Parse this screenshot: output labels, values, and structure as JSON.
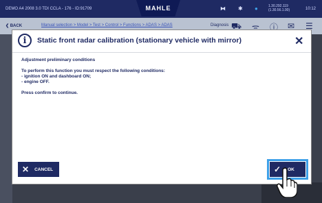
{
  "statusbar": {
    "vehicle": "DEMO A4 2008 3.0 TDI CCLA - 176 - ID:91709",
    "brand": "MAHLE",
    "ip_line1": "1.30.292.119",
    "ip_line2": "(1.30.56.1.00)",
    "clock": "10:12",
    "icons": [
      "vci-icon",
      "bluetooth-icon",
      "wifi-dot-icon"
    ]
  },
  "navbar": {
    "back": "BACK",
    "crumbs": "Manual selection  >  Model  >  Test  >  Control  >  Functions  >  ADAS  >  ADAS",
    "diag": "Diagnosis",
    "icons": [
      "car-icon",
      "signal-icon",
      "info-icon",
      "mail-icon",
      "menu-icon"
    ]
  },
  "dialog": {
    "title": "Static front radar calibration (stationary vehicle with mirror)",
    "subtitle": "Adjustment preliminary conditions",
    "intro": "To perform this function you must respect the following conditions:",
    "conditions": [
      "- ignition ON and dashboard ON;",
      "- engine OFF."
    ],
    "confirm": "Press confirm to continue.",
    "cancel_label": "CANCEL",
    "ok_label": "OK"
  },
  "colors": {
    "navy": "#1f2a63",
    "highlight": "#3da0e8",
    "statusbar": "#1f2a63",
    "navbar": "#b9c2d1"
  }
}
